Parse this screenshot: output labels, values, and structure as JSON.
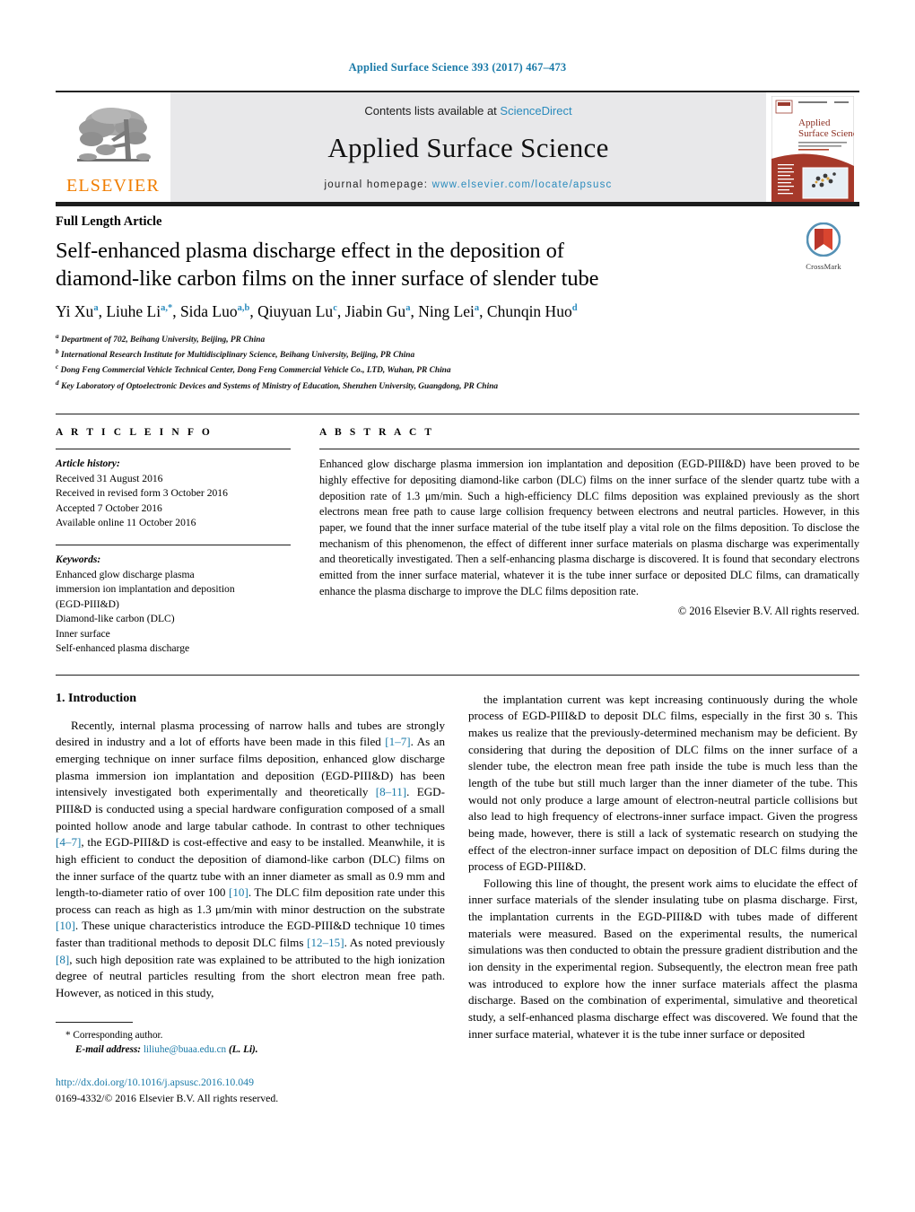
{
  "running_head": "Applied Surface Science 393 (2017) 467–473",
  "masthead": {
    "contents_prefix": "Contents lists available at ",
    "sciencedirect": "ScienceDirect",
    "journal_title": "Applied Surface Science",
    "homepage_prefix": "journal homepage: ",
    "homepage_url": "www.elsevier.com/locate/apsusc",
    "elsevier_wordmark": "ELSEVIER",
    "cover_title_line1": "Applied",
    "cover_title_line2": "Surface Science",
    "link_color": "#2a8bbd",
    "elsevier_orange": "#f07d00",
    "band_gray": "#e8e8ea"
  },
  "article": {
    "type": "Full Length Article",
    "title_line1": "Self-enhanced plasma discharge effect in the deposition of",
    "title_line2": "diamond-like carbon films on the inner surface of slender tube",
    "authors": [
      {
        "name": "Yi Xu",
        "sup": "a"
      },
      {
        "name": "Liuhe Li",
        "sup": "a,*"
      },
      {
        "name": "Sida Luo",
        "sup": "a,b"
      },
      {
        "name": "Qiuyuan Lu",
        "sup": "c"
      },
      {
        "name": "Jiabin Gu",
        "sup": "a"
      },
      {
        "name": "Ning Lei",
        "sup": "a"
      },
      {
        "name": "Chunqin Huo",
        "sup": "d"
      }
    ],
    "affiliations": [
      {
        "sup": "a",
        "text": "Department of 702, Beihang University, Beijing, PR China"
      },
      {
        "sup": "b",
        "text": "International Research Institute for Multidisciplinary Science, Beihang University, Beijing, PR China"
      },
      {
        "sup": "c",
        "text": "Dong Feng Commercial Vehicle Technical Center, Dong Feng Commercial Vehicle Co., LTD, Wuhan, PR China"
      },
      {
        "sup": "d",
        "text": "Key Laboratory of Optoelectronic Devices and Systems of Ministry of Education, Shenzhen University, Guangdong, PR China"
      }
    ],
    "crossmark_label": "CrossMark"
  },
  "article_info": {
    "heading": "A R T I C L E   I N F O",
    "history_heading": "Article history:",
    "history": [
      "Received 31 August 2016",
      "Received in revised form 3 October 2016",
      "Accepted 7 October 2016",
      "Available online 11 October 2016"
    ],
    "keywords_heading": "Keywords:",
    "keywords": [
      "Enhanced glow discharge plasma",
      "immersion ion implantation and deposition",
      "(EGD-PIII&D)",
      "Diamond-like carbon (DLC)",
      "Inner surface",
      "Self-enhanced plasma discharge"
    ]
  },
  "abstract": {
    "heading": "A B S T R A C T",
    "text": "Enhanced glow discharge plasma immersion ion implantation and deposition (EGD-PIII&D) have been proved to be highly effective for depositing diamond-like carbon (DLC) films on the inner surface of the slender quartz tube with a deposition rate of 1.3 μm/min. Such a high-efficiency DLC films deposition was explained previously as the short electrons mean free path to cause large collision frequency between electrons and neutral particles. However, in this paper, we found that the inner surface material of the tube itself play a vital role on the films deposition. To disclose the mechanism of this phenomenon, the effect of different inner surface materials on plasma discharge was experimentally and theoretically investigated. Then a self-enhancing plasma discharge is discovered. It is found that secondary electrons emitted from the inner surface material, whatever it is the tube inner surface or deposited DLC films, can dramatically enhance the plasma discharge to improve the DLC films deposition rate.",
    "copyright": "© 2016 Elsevier B.V. All rights reserved."
  },
  "body": {
    "section_title": "1.  Introduction",
    "left_paragraphs": [
      "Recently, internal plasma processing of narrow halls and tubes are strongly desired in industry and a lot of efforts have been made in this filed [1–7]. As an emerging technique on inner surface films deposition, enhanced glow discharge plasma immersion ion implantation and deposition (EGD-PIII&D) has been intensively investigated both experimentally and theoretically [8–11]. EGD-PIII&D is conducted using a special hardware configuration composed of a small pointed hollow anode and large tabular cathode. In contrast to other techniques [4–7], the EGD-PIII&D is cost-effective and easy to be installed. Meanwhile, it is high efficient to conduct the deposition of diamond-like carbon (DLC) films on the inner surface of the quartz tube with an inner diameter as small as 0.9 mm and length-to-diameter ratio of over 100 [10]. The DLC film deposition rate under this process can reach as high as 1.3 μm/min with minor destruction on the substrate [10]. These unique characteristics introduce the EGD-PIII&D technique 10 times faster than traditional methods to deposit DLC films [12–15]. As noted previously [8], such high deposition rate was explained to be attributed to the high ionization degree of neutral particles resulting from the short electron mean free path. However, as noticed in this study,"
    ],
    "right_paragraphs": [
      "the implantation current was kept increasing continuously during the whole process of EGD-PIII&D to deposit DLC films, especially in the first 30 s. This makes us realize that the previously-determined mechanism may be deficient. By considering that during the deposition of DLC films on the inner surface of a slender tube, the electron mean free path inside the tube is much less than the length of the tube but still much larger than the inner diameter of the tube. This would not only produce a large amount of electron-neutral particle collisions but also lead to high frequency of electrons-inner surface impact. Given the progress being made, however, there is still a lack of systematic research on studying the effect of the electron-inner surface impact on deposition of DLC films during the process of EGD-PIII&D.",
      "Following this line of thought, the present work aims to elucidate the effect of inner surface materials of the slender insulating tube on plasma discharge. First, the implantation currents in the EGD-PIII&D with tubes made of different materials were measured. Based on the experimental results, the numerical simulations was then conducted to obtain the pressure gradient distribution and the ion density in the experimental region. Subsequently, the electron mean free path was introduced to explore how the inner surface materials affect the plasma discharge. Based on the combination of experimental, simulative and theoretical study, a self-enhanced plasma discharge effect was discovered. We found that the inner surface material, whatever it is the tube inner surface or deposited"
    ]
  },
  "footer": {
    "corresponding_marker": "*",
    "corresponding_text": "Corresponding author.",
    "email_label": "E-mail address:",
    "email": "liliuhe@buaa.edu.cn",
    "email_suffix": "(L. Li).",
    "doi": "http://dx.doi.org/10.1016/j.apsusc.2016.10.049",
    "issn_line": "0169-4332/© 2016 Elsevier B.V. All rights reserved."
  }
}
